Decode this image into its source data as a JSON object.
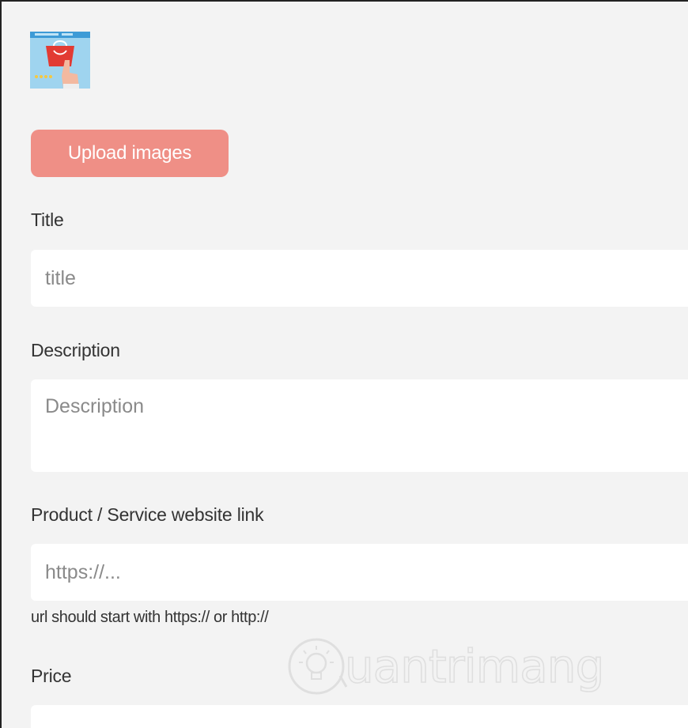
{
  "upload": {
    "thumbnail_icon": "shopping-bag-hand-icon",
    "button_label": "Upload images"
  },
  "fields": {
    "title": {
      "label": "Title",
      "placeholder": "title"
    },
    "description": {
      "label": "Description",
      "placeholder": "Description"
    },
    "link": {
      "label": "Product / Service website link",
      "placeholder": "https://...",
      "hint": "url should start with https:// or http://"
    },
    "price": {
      "label": "Price",
      "placeholder": ""
    }
  },
  "watermark": {
    "text": "uantrimang",
    "icon": "lightbulb-icon"
  },
  "colors": {
    "accent": "#ef8f86",
    "background": "#f3f3f3",
    "field": "#ffffff"
  }
}
